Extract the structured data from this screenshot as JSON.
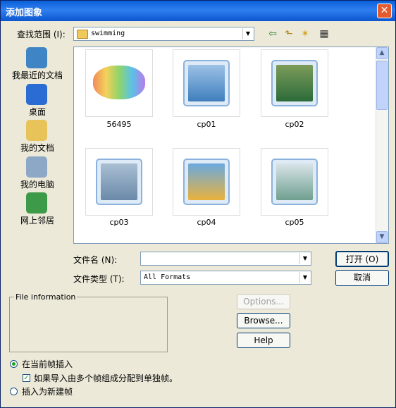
{
  "window": {
    "title": "添加图象",
    "close_glyph": "✕"
  },
  "lookin": {
    "label": "查找范围 (I):",
    "value": "swimming"
  },
  "toolbar": {
    "back_glyph": "⇦",
    "up_glyph": "⬑",
    "newfolder_glyph": "✶",
    "views_glyph": "▦"
  },
  "places": [
    {
      "label": "我最近的文档",
      "icon": "recent-documents-icon",
      "color": "#3f84c4"
    },
    {
      "label": "桌面",
      "icon": "desktop-icon",
      "color": "#2b6cd4"
    },
    {
      "label": "我的文档",
      "icon": "my-documents-folder-icon",
      "color": "#e8c35a"
    },
    {
      "label": "我的电脑",
      "icon": "my-computer-icon",
      "color": "#8da7c6"
    },
    {
      "label": "网上邻居",
      "icon": "network-places-icon",
      "color": "#3d9a48"
    }
  ],
  "files": [
    {
      "name": "56495",
      "color": "#f3b56b"
    },
    {
      "name": "cp01",
      "color": "#3f7fbd"
    },
    {
      "name": "cp02",
      "color": "#2c6b3a"
    },
    {
      "name": "cp03",
      "color": "#6b89a9"
    },
    {
      "name": "cp04",
      "color": "#e9b23c"
    },
    {
      "name": "cp05",
      "color": "#6f9f8f"
    }
  ],
  "filename": {
    "label": "文件名 (N):",
    "value": ""
  },
  "filetype": {
    "label": "文件类型 (T):",
    "value": "All Formats"
  },
  "buttons": {
    "open": "打开 (O)",
    "cancel": "取消",
    "options": "Options...",
    "browse": "Browse...",
    "help": "Help"
  },
  "file_information": {
    "legend": "File information"
  },
  "insert_options": {
    "insert_current": "在当前帧插入",
    "distribute_frames": "如果导入由多个帧组成分配到单独帧。",
    "insert_new": "插入为新建帧"
  },
  "scroll": {
    "up_glyph": "▲",
    "down_glyph": "▼",
    "dropdown_glyph": "▼"
  }
}
